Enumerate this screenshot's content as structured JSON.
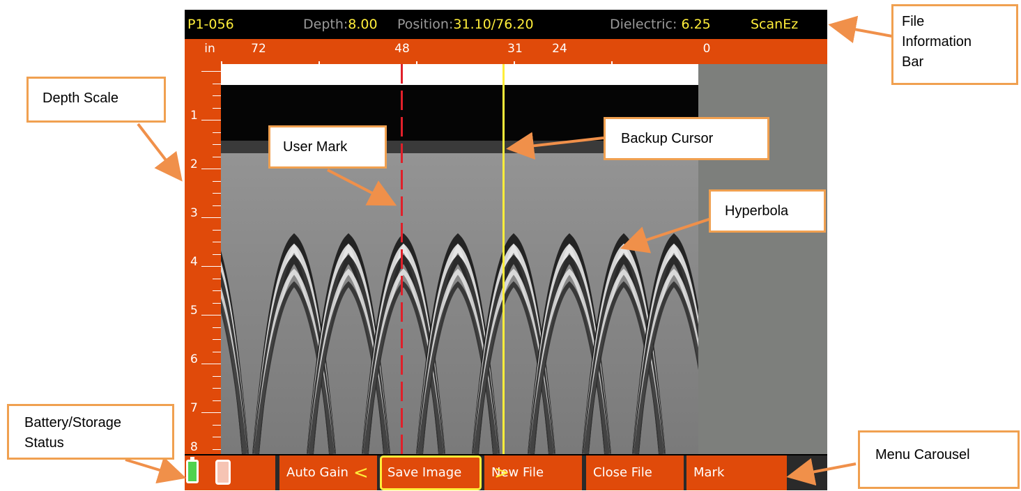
{
  "info_bar": {
    "file_id": "P1-056",
    "depth_label": "Depth:",
    "depth_value": "8.00",
    "position_label": "Position:",
    "position_value": "31.10/76.20",
    "dielectric_label": "Dielectric:",
    "dielectric_value": "6.25",
    "mode": "ScanEz"
  },
  "position_scale": {
    "unit": "in",
    "labels": [
      "72",
      "48",
      "31",
      "24",
      "0"
    ]
  },
  "depth_scale": {
    "labels": [
      "1",
      "2",
      "3",
      "4",
      "5",
      "6",
      "7",
      "8"
    ]
  },
  "menu": {
    "items": [
      "Auto Gain",
      "Save Image",
      "New File",
      "Close File",
      "Mark"
    ],
    "selected": "Save Image",
    "prev_arrow": "<",
    "next_arrow": ">"
  },
  "callouts": {
    "file_information_bar": "File Information Bar",
    "depth_scale": "Depth Scale",
    "user_mark": "User Mark",
    "backup_cursor": "Backup Cursor",
    "hyperbola": "Hyperbola",
    "battery_storage": "Battery/Storage Status",
    "menu_carousel": "Menu Carousel"
  },
  "colors": {
    "screen_orange": "#e04a0a",
    "highlight_yellow": "#ffee3a",
    "user_mark_red": "#e0202a",
    "callout_border": "#f0a050",
    "arrow": "#f0904a",
    "battery_green": "#4fd24f"
  },
  "icons": {
    "battery": "battery-icon",
    "storage": "sd-card-icon"
  }
}
